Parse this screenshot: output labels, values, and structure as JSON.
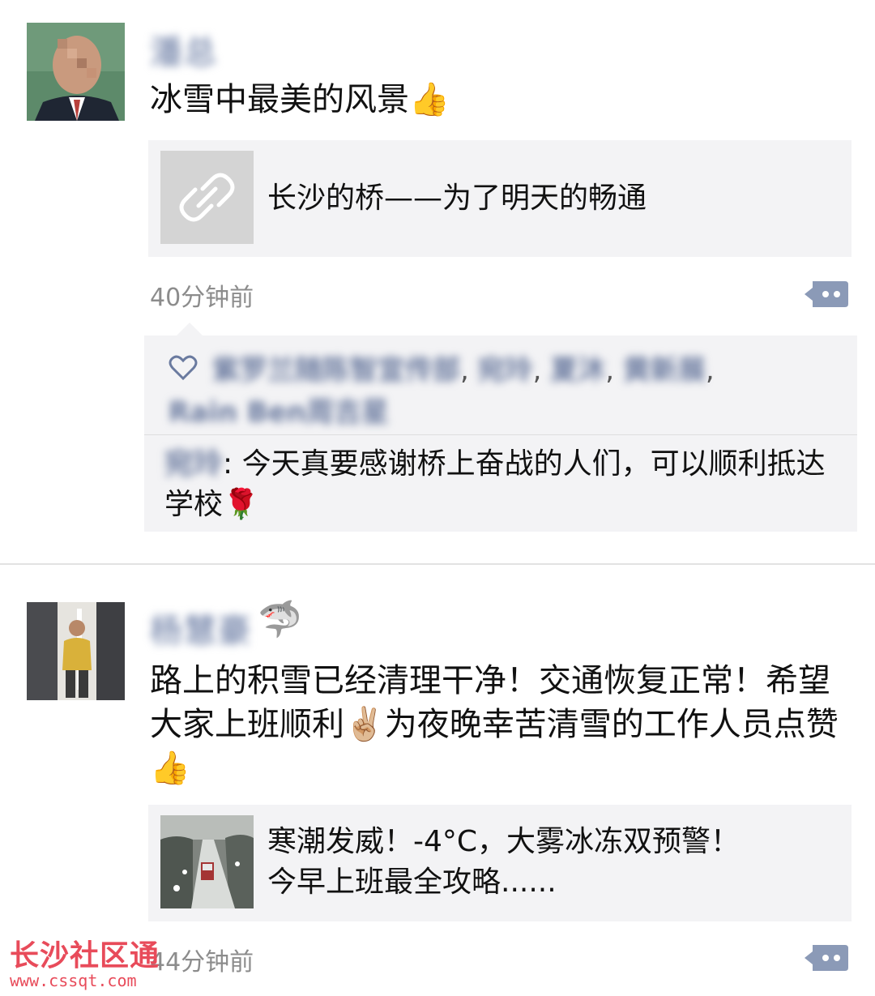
{
  "posts": [
    {
      "author": "潘总",
      "text": "冰雪中最美的风景👍",
      "link_title": "长沙的桥——为了明天的畅通",
      "time": "40分钟前",
      "likes": [
        "紫罗兰随陈智宣传部",
        "宛玲",
        "夏沐",
        "黄新展",
        "Rain Ben周吉星"
      ],
      "comment": {
        "name": "宛玲",
        "text": ": 今天真要感谢桥上奋战的人们，可以顺利抵达学校🌹"
      }
    },
    {
      "author": "杨慧豪",
      "author_emoji": "🦈",
      "text": "路上的积雪已经清理干净！交通恢复正常！希望大家上班顺利✌🏼为夜晚幸苦清雪的工作人员点赞👍",
      "link_title_line1": "寒潮发威！-4°C，大雾冰冻双预警！",
      "link_title_line2": "今早上班最全攻略......",
      "time": "44分钟前"
    }
  ],
  "watermark": {
    "title": "长沙社区通",
    "url": "www.cssqt.com"
  },
  "icons": {
    "like": "heart-outline-icon",
    "link": "link-icon",
    "more": "comment-more-icon"
  },
  "colors": {
    "name": "#576b95",
    "background": "#f3f3f5",
    "time": "#8c8c8c",
    "watermark": "#e84b5a"
  }
}
